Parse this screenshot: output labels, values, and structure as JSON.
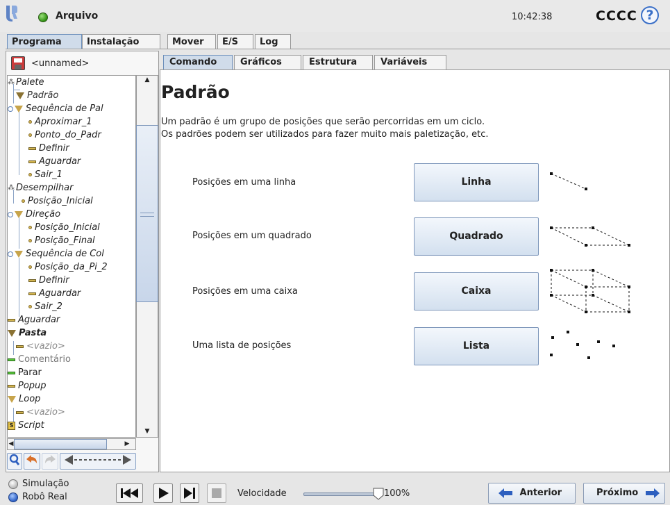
{
  "topbar": {
    "file_label": "Arquivo",
    "clock": "10:42:38",
    "robot_name": "CCCC",
    "help_glyph": "?"
  },
  "main_tabs": [
    "Programa",
    "Instalação",
    "Mover",
    "E/S",
    "Log"
  ],
  "program": {
    "name": "<unnamed>"
  },
  "tree": [
    {
      "label": "Palete",
      "icon": "pallet-icon"
    },
    {
      "label": "Padrão",
      "icon": "pattern-icon"
    },
    {
      "label": "Sequência de Pal",
      "icon": "sequence-icon"
    },
    {
      "label": "Aproximar_1",
      "icon": "waypoint-icon"
    },
    {
      "label": "Ponto_do_Padr",
      "icon": "waypoint-icon"
    },
    {
      "label": "Definir",
      "icon": "set-icon"
    },
    {
      "label": "Aguardar",
      "icon": "wait-icon"
    },
    {
      "label": "Sair_1",
      "icon": "waypoint-icon"
    },
    {
      "label": "Desempilhar",
      "icon": "pallet-icon"
    },
    {
      "label": "Posição_Inicial",
      "icon": "waypoint-icon"
    },
    {
      "label": "Direção",
      "icon": "direction-icon"
    },
    {
      "label": "Posição_Inicial",
      "icon": "waypoint-icon"
    },
    {
      "label": "Posição_Final",
      "icon": "waypoint-icon"
    },
    {
      "label": "Sequência de Col",
      "icon": "sequence-icon"
    },
    {
      "label": "Posição_da_Pi_2",
      "icon": "waypoint-icon"
    },
    {
      "label": "Definir",
      "icon": "set-icon"
    },
    {
      "label": "Aguardar",
      "icon": "wait-icon"
    },
    {
      "label": "Sair_2",
      "icon": "waypoint-icon"
    },
    {
      "label": "Aguardar",
      "icon": "wait-icon"
    },
    {
      "label": "Pasta",
      "icon": "folder-icon"
    },
    {
      "label": "<vazio>",
      "icon": "empty-icon"
    },
    {
      "label": "Comentário",
      "icon": "comment-icon"
    },
    {
      "label": "Parar",
      "icon": "halt-icon"
    },
    {
      "label": "Popup",
      "icon": "popup-icon"
    },
    {
      "label": "Loop",
      "icon": "loop-icon"
    },
    {
      "label": "<vazio>",
      "icon": "empty-icon"
    },
    {
      "label": "Script",
      "icon": "script-icon"
    }
  ],
  "sub_tabs": [
    "Comando",
    "Gráficos",
    "Estrutura",
    "Variáveis"
  ],
  "content": {
    "title": "Padrão",
    "desc_line1": "Um padrão é um grupo de posições que serão percorridas em um ciclo.",
    "desc_line2": "Os padrões podem ser utilizados para fazer muito mais paletização, etc.",
    "rows": [
      {
        "label": "Posições em uma linha",
        "button": "Linha"
      },
      {
        "label": "Posições em um quadrado",
        "button": "Quadrado"
      },
      {
        "label": "Posições em uma caixa",
        "button": "Caixa"
      },
      {
        "label": "Uma lista de posições",
        "button": "Lista"
      }
    ]
  },
  "bottombar": {
    "mode_sim": "Simulação",
    "mode_real": "Robô Real",
    "speed_label": "Velocidade",
    "speed_value": "100%",
    "speed_fraction": 1.0,
    "prev_label": "Anterior",
    "next_label": "Próximo"
  },
  "colors": {
    "tab_active": "#d0dcea",
    "button_gradient_top": "#f3f7fc",
    "button_gradient_bottom": "#d3e0ef",
    "accent_blue": "#3a6fc7"
  }
}
